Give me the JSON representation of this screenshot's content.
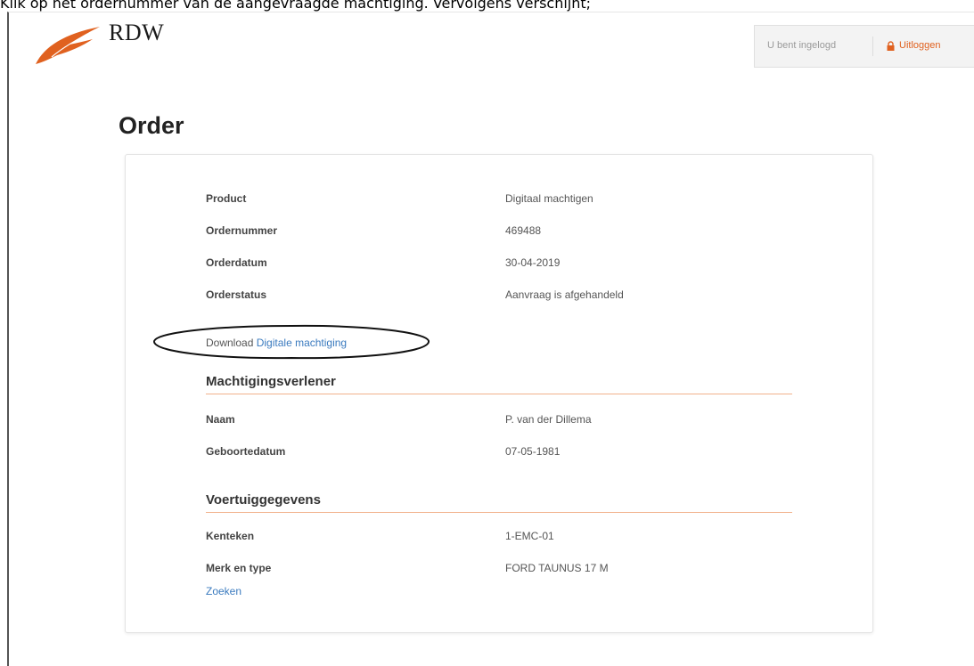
{
  "caption": "Klik op het ordernummer van de aangevraagde machtiging. Vervolgens verschijnt;",
  "header": {
    "logo_text": "RDW",
    "login_status": "U bent ingelogd",
    "logout_label": "Uitloggen"
  },
  "page": {
    "title": "Order"
  },
  "order": {
    "rows": [
      {
        "label": "Product",
        "value": "Digitaal machtigen"
      },
      {
        "label": "Ordernummer",
        "value": "469488"
      },
      {
        "label": "Orderdatum",
        "value": "30-04-2019"
      },
      {
        "label": "Orderstatus",
        "value": "Aanvraag is afgehandeld"
      }
    ],
    "download_prefix": "Download",
    "download_link": "Digitale machtiging"
  },
  "grantor": {
    "title": "Machtigingsverlener",
    "rows": [
      {
        "label": "Naam",
        "value": "P. van der Dillema"
      },
      {
        "label": "Geboortedatum",
        "value": "07-05-1981"
      }
    ]
  },
  "vehicle": {
    "title": "Voertuiggegevens",
    "rows": [
      {
        "label": "Kenteken",
        "value": "1-EMC-01"
      },
      {
        "label": "Merk en type",
        "value": "FORD TAUNUS 17 M"
      }
    ]
  },
  "search_link": "Zoeken",
  "colors": {
    "accent": "#e0611f",
    "link": "#3b7bbf",
    "divider": "#f2b28c"
  }
}
